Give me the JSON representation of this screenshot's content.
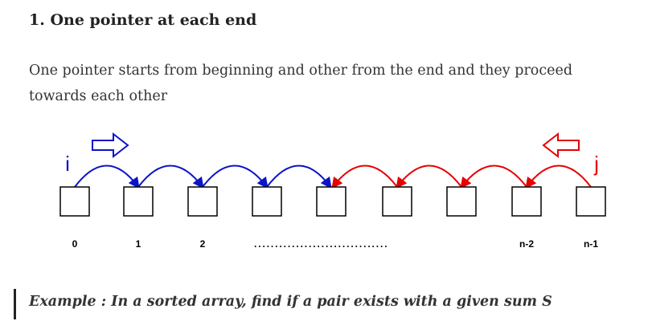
{
  "heading": "1. One pointer at each end",
  "paragraph": "One pointer starts from beginning and other from the end and they proceed towards each other",
  "diagram": {
    "left_pointer": "i",
    "right_pointer": "j",
    "index_labels": [
      "0",
      "1",
      "2",
      "n-2",
      "n-1"
    ],
    "ellipsis": "................................",
    "colors": {
      "left": "#0a14c8",
      "right": "#e60000",
      "box": "#000000"
    }
  },
  "example": "Example : In a sorted array, find if a pair exists with a given sum S"
}
